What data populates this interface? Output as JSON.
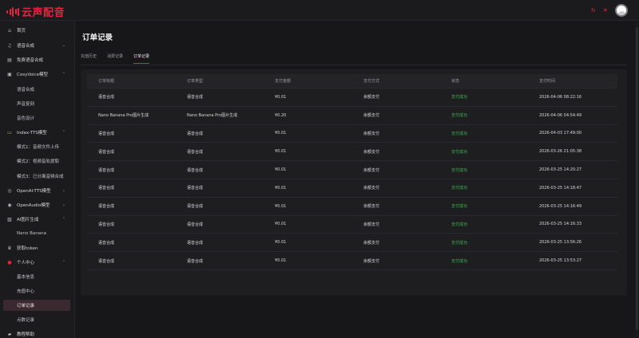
{
  "brand": {
    "name": "云声配音",
    "accent": "#e5243f"
  },
  "topbar": {
    "refresh_icon": "refresh-icon",
    "theme_icon": "sun-icon",
    "avatar_icon": "user-avatar"
  },
  "sidebar": {
    "items": [
      {
        "label": "首页",
        "icon": "home-icon",
        "chevron": ""
      },
      {
        "label": "语音合成",
        "icon": "music-icon",
        "chevron": "⌄"
      },
      {
        "label": "免费语音合成",
        "icon": "media-icon",
        "chevron": ""
      },
      {
        "label": "CosyVoice模型",
        "icon": "model-icon",
        "chevron": "⌃"
      },
      {
        "label": "语音合成",
        "icon": "",
        "chevron": ""
      },
      {
        "label": "声音复刻",
        "icon": "",
        "chevron": ""
      },
      {
        "label": "音色设计",
        "icon": "",
        "chevron": ""
      },
      {
        "label": "Index-TTS模型",
        "icon": "package-icon",
        "chevron": "⌃"
      },
      {
        "label": "模式1：音频文件上传",
        "icon": "",
        "chevron": ""
      },
      {
        "label": "模式2：视频音轨提取",
        "icon": "",
        "chevron": ""
      },
      {
        "label": "模式3：已分离音频合成",
        "icon": "",
        "chevron": ""
      },
      {
        "label": "OpenAI-TTS模型",
        "icon": "openai-icon",
        "chevron": "⌄"
      },
      {
        "label": "OpenAudio模型",
        "icon": "audio-icon",
        "chevron": "⌄"
      },
      {
        "label": "AI图片生成",
        "icon": "image-icon",
        "chevron": "⌃"
      },
      {
        "label": "Nano Banana",
        "icon": "",
        "chevron": ""
      },
      {
        "label": "获取token",
        "icon": "crown-icon",
        "chevron": ""
      },
      {
        "label": "个人中心",
        "icon": "user-icon",
        "chevron": "⌃"
      },
      {
        "label": "基本信息",
        "icon": "",
        "chevron": ""
      },
      {
        "label": "充值中心",
        "icon": "",
        "chevron": ""
      },
      {
        "label": "订单记录",
        "icon": "",
        "chevron": ""
      },
      {
        "label": "点数记录",
        "icon": "",
        "chevron": ""
      },
      {
        "label": "教程帮助",
        "icon": "book-icon",
        "chevron": ""
      }
    ]
  },
  "main": {
    "title": "订单记录",
    "tabs": [
      {
        "label": "充值历史"
      },
      {
        "label": "消费记录"
      },
      {
        "label": "订单记录",
        "active": true
      }
    ],
    "table": {
      "columns": [
        "订单标题",
        "订单类型",
        "支付金额",
        "支付方式",
        "状态",
        "支付时间"
      ],
      "rows": [
        [
          "语音合成",
          "语音合成",
          "¥0.01",
          "余额支付",
          "支付成功",
          "2026-04-06 08:22:16"
        ],
        [
          "Nano Banana Pro图片生成",
          "Nano Banana Pro图片生成",
          "¥0.20",
          "余额支付",
          "支付成功",
          "2026-04-06 04:54:49"
        ],
        [
          "语音合成",
          "语音合成",
          "¥0.01",
          "余额支付",
          "支付成功",
          "2026-04-03 17:49:00"
        ],
        [
          "语音合成",
          "语音合成",
          "¥0.01",
          "余额支付",
          "支付成功",
          "2026-03-26 21:05:38"
        ],
        [
          "语音合成",
          "语音合成",
          "¥0.01",
          "余额支付",
          "支付成功",
          "2026-03-25 14:20:27"
        ],
        [
          "语音合成",
          "语音合成",
          "¥0.01",
          "余额支付",
          "支付成功",
          "2026-03-25 14:18:47"
        ],
        [
          "语音合成",
          "语音合成",
          "¥0.01",
          "余额支付",
          "支付成功",
          "2026-03-25 14:16:49"
        ],
        [
          "语音合成",
          "语音合成",
          "¥0.01",
          "余额支付",
          "支付成功",
          "2026-03-25 14:16:33"
        ],
        [
          "语音合成",
          "语音合成",
          "¥0.01",
          "余额支付",
          "支付成功",
          "2026-03-25 13:56:26"
        ],
        [
          "语音合成",
          "语音合成",
          "¥0.01",
          "余额支付",
          "支付成功",
          "2026-03-25 13:53:27"
        ]
      ]
    }
  },
  "colors": {
    "success": "#3fb64f",
    "background": "#17171a",
    "panel": "#1e1e21"
  }
}
